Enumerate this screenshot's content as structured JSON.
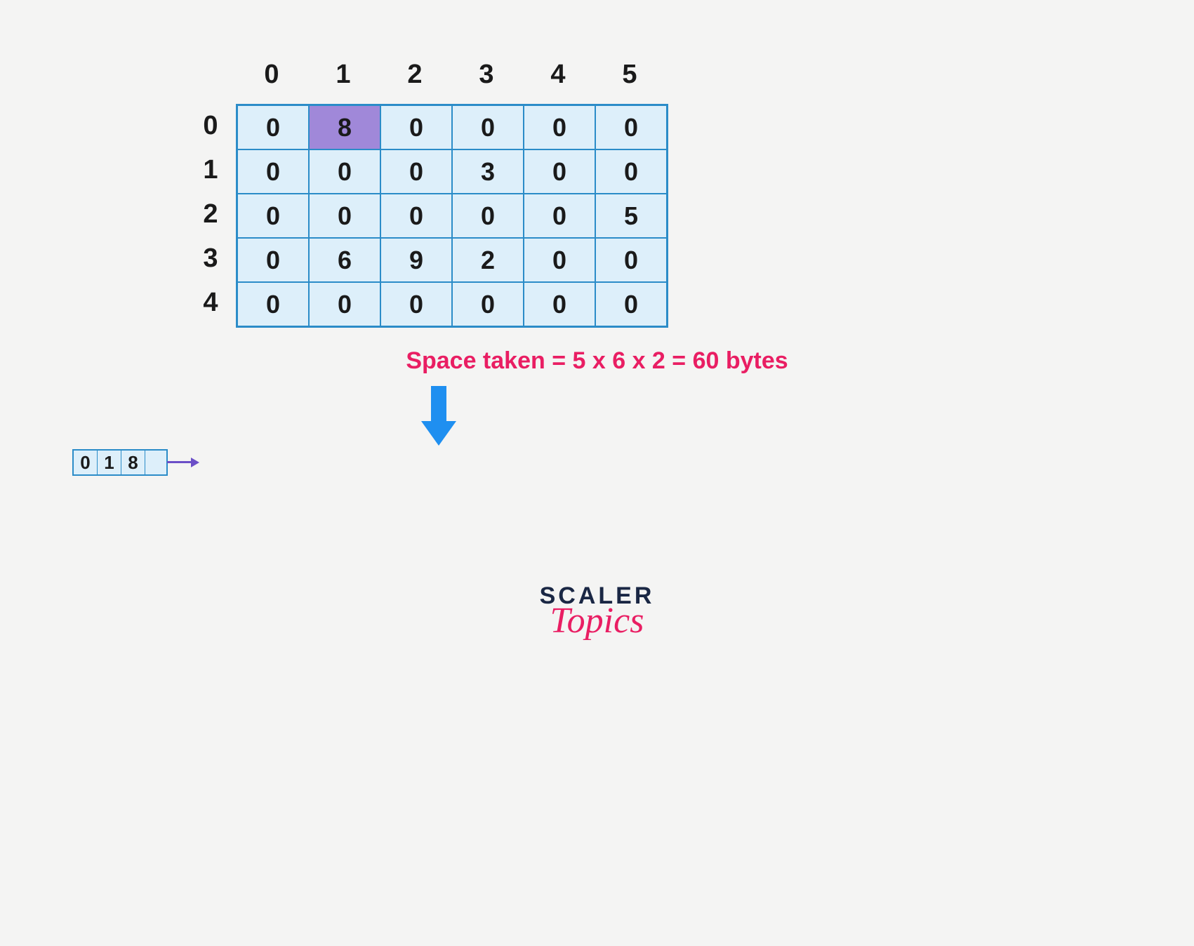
{
  "chart_data": {
    "type": "table",
    "col_headers": [
      "0",
      "1",
      "2",
      "3",
      "4",
      "5"
    ],
    "row_headers": [
      "0",
      "1",
      "2",
      "3",
      "4"
    ],
    "cells": [
      [
        "0",
        "8",
        "0",
        "0",
        "0",
        "0"
      ],
      [
        "0",
        "0",
        "0",
        "3",
        "0",
        "0"
      ],
      [
        "0",
        "0",
        "0",
        "0",
        "0",
        "5"
      ],
      [
        "0",
        "6",
        "9",
        "2",
        "0",
        "0"
      ],
      [
        "0",
        "0",
        "0",
        "0",
        "0",
        "0"
      ]
    ],
    "highlighted_cell": {
      "row": 0,
      "col": 1
    },
    "caption": "Space taken = 5 x 6 x 2 = 60 bytes",
    "node_triplet": [
      "0",
      "1",
      "8",
      ""
    ],
    "logo": {
      "line1": "SCALER",
      "line2": "Topics"
    }
  }
}
